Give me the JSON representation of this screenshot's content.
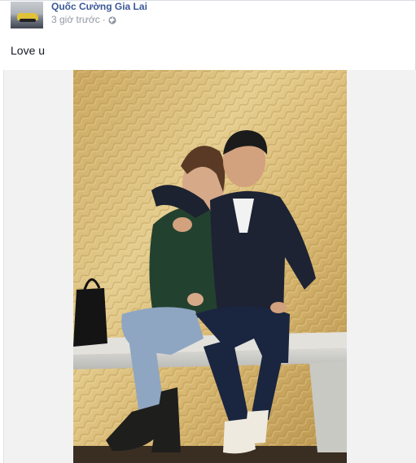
{
  "post": {
    "author": "Quốc Cường Gia Lai",
    "timestamp": "3 giờ trước",
    "separator": "·",
    "privacy_icon": "globe-icon",
    "text": "Love u"
  },
  "photo": {
    "subject": "photo-of-couple-sitting-on-bench"
  },
  "colors": {
    "link": "#3b5998",
    "meta": "#9197a3",
    "text": "#141823",
    "frame_bg": "#f2f2f2"
  }
}
